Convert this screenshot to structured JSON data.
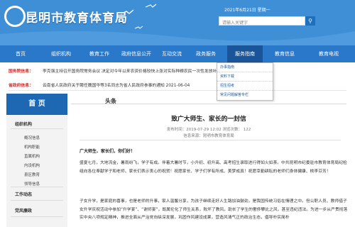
{
  "header": {
    "site_name": "昆明市教育体育局",
    "date": "2021年6月21日 星期一",
    "search_placeholder": "请输入关键字",
    "search_icon": "search-icon"
  },
  "nav": {
    "items": [
      {
        "label": "首页"
      },
      {
        "label": "组织机构"
      },
      {
        "label": "教育工作"
      },
      {
        "label": "政府信息公开"
      },
      {
        "label": "互动交流"
      },
      {
        "label": "政务服务"
      },
      {
        "label": "服务指南"
      },
      {
        "label": "教育信息"
      },
      {
        "label": "教育电视"
      }
    ],
    "active_index": 6
  },
  "dropdown": {
    "items": [
      {
        "label": "办事指南"
      },
      {
        "label": "资料下载"
      },
      {
        "label": "招生招考"
      },
      {
        "label": "常见问题解答专栏"
      }
    ]
  },
  "tickers": [
    {
      "label": "国务院信息：",
      "text": "李克强主持召开国务院常务会议 决定对今年以来农资价格较快上涨对实际种粮农民一次性发放补贴"
    },
    {
      "label": "省政府信息：",
      "text": "云南省人民政府关于聘任魏国华等3名同志为省人民政府参事的通知 2021-06-04"
    }
  ],
  "sidebar": {
    "home": "首 页",
    "sections": [
      {
        "label": "组织机构",
        "subs": [
          "概况信息",
          "机构职能",
          "直属机构",
          "内设机构",
          "县区教育",
          "领导信息"
        ]
      },
      {
        "label": "工作动态",
        "subs": []
      },
      {
        "label": "党风廉政",
        "subs": []
      }
    ]
  },
  "article": {
    "crumb": "头条",
    "title": "致广大师生、家长的一封信",
    "meta": "发布时间：2019-07-29 12:02    浏览次数：  122",
    "source": "信息来源：昆明市教育体育局",
    "greeting": "广大师生、家长们，你们好！",
    "paragraphs": [
      "盛夏七月，大地流金，暑雨纷飞，学子有成。伴着大暑时节，小升初、初升高、高考招生录取进行得如火如荼。中共昆明市纪委驻市教育体育局纪检组向各位奉献学子和老师、家长们表示衷心的祝贺！祝愿家长、学子们学有所成、美梦成真！祝愿幸勤耕耘的老师们身体健康、桃李芬芳！",
      "子女升学，是家庭的喜事，也是老师的升事，家人温馨分享，为孩子继续走好人生路加油鼓劲，是我国传统习俗在情理之中。但公职人员、教师借子女升学庆祝活动中参加“升学宴”、“谢师宴”，既属伦化了师生关系，败坏了教风，助长了学生的奢侈攀比之风，甚至违纪违法。为进一步从严贯彻落实中央八项规定精神，推进全面从严治党向纵深发展，巩固作风建设成果，营造风清气正的政治生态，倡导朴实简朴"
    ]
  },
  "float_panel": {
    "label": "分享"
  }
}
